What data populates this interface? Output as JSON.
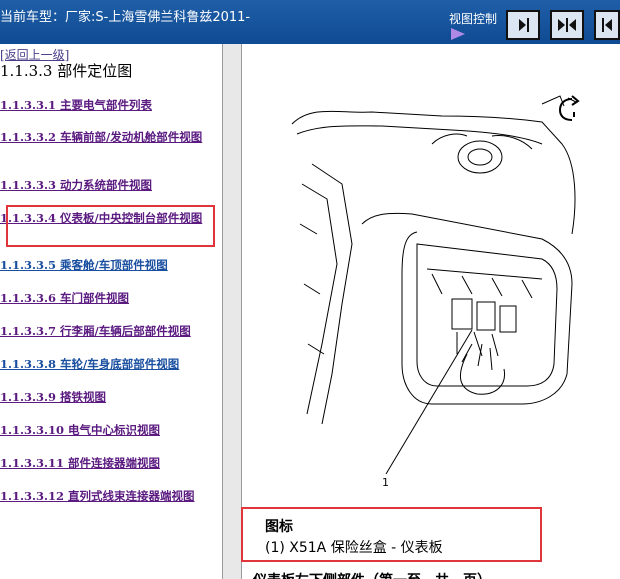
{
  "header": {
    "title": "当前车型：厂家:S-上海雪佛兰科鲁兹2011-",
    "view_control_label": "视图控制",
    "buttons": [
      {
        "name": "expand-right-button",
        "icon": "arrow-right-bar-icon"
      },
      {
        "name": "split-view-button",
        "icon": "double-arrow-icon"
      },
      {
        "name": "expand-left-button",
        "icon": "arrow-left-bar-icon"
      }
    ]
  },
  "sidebar": {
    "back_link": "[返回上一级]",
    "section_title": "1.1.3.3 部件定位图",
    "items": [
      {
        "label": "1.1.3.3.1 主要电气部件列表"
      },
      {
        "label": "1.1.3.3.2 车辆前部/发动机舱部件视图"
      },
      {
        "label": "1.1.3.3.3 动力系统部件视图"
      },
      {
        "label": "1.1.3.3.4 仪表板/中央控制台部件视图"
      },
      {
        "label": "1.1.3.3.5 乘客舱/车顶部件视图"
      },
      {
        "label": "1.1.3.3.6 车门部件视图"
      },
      {
        "label": "1.1.3.3.7 行李厢/车辆后部部件视图"
      },
      {
        "label": "1.1.3.3.8 车轮/车身底部部件视图"
      },
      {
        "label": "1.1.3.3.9 搭铁视图"
      },
      {
        "label": "1.1.3.3.10 电气中心标识视图"
      },
      {
        "label": "1.1.3.3.11 部件连接器端视图"
      },
      {
        "label": "1.1.3.3.12 直列式线束连接器端视图"
      }
    ]
  },
  "diagram": {
    "legend_title": "图标",
    "legend_items": [
      "(1) X51A 保险丝盒 - 仪表板"
    ],
    "callout_number": "1",
    "next_heading": "仪表板左下侧部件（第一至…共…页）"
  },
  "colors": {
    "header_bg": "#1a5aa3",
    "highlight_box": "#e0353b",
    "nav_link": "#5a1a80",
    "nav_link_blue": "#1a4fa0"
  }
}
